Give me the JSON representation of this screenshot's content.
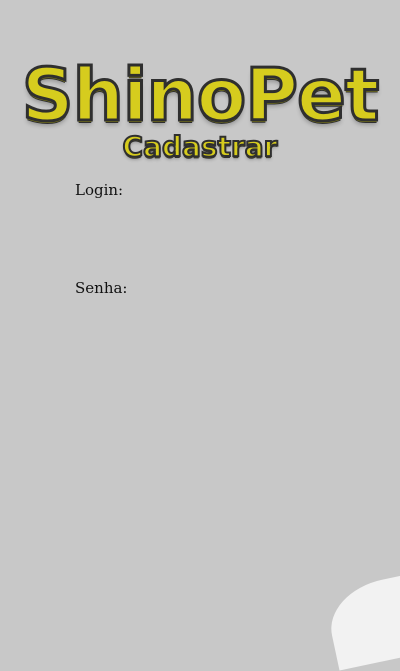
{
  "logo": {
    "title": "ShinoPet",
    "subtitle": "Cadastrar"
  },
  "form": {
    "login_label": "Login:",
    "login_value": "",
    "password_label": "Senha:",
    "password_value": ""
  },
  "colors": {
    "background": "#c8c8c8",
    "logo_fill": "#d6cc1e",
    "logo_outline": "#2f2f2f"
  }
}
